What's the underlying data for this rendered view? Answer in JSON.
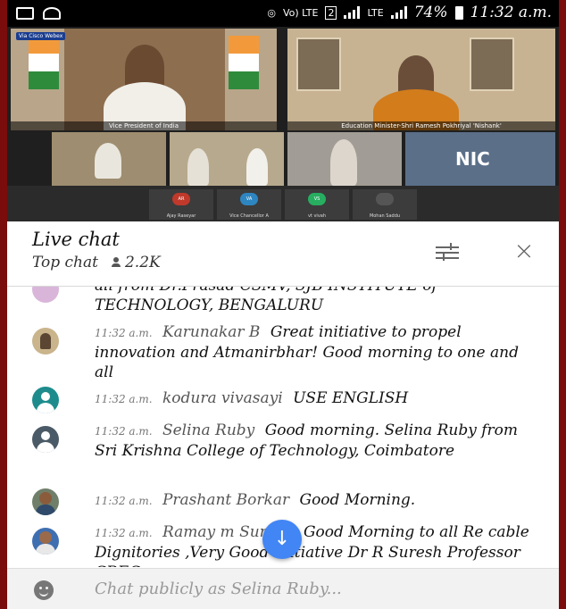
{
  "status_bar": {
    "indicators": [
      "Vo) LTE",
      "2",
      "LTE"
    ],
    "battery": "74%",
    "time": "11:32 a.m."
  },
  "video": {
    "webex_badge": "Via Cisco Webex",
    "main_caption_left": "Vice President of India",
    "main_caption_right": "Education Minister-Shri Ramesh Pokhriyal 'Nishank'",
    "nic_label": "NIC",
    "thumbnails": [
      {
        "initials": "AR",
        "name": "Ajay Raseyar",
        "color": "#c0392b"
      },
      {
        "initials": "VA",
        "name": "Vice Chancellor A",
        "color": "#2e86c1"
      },
      {
        "initials": "VS",
        "name": "vt vivah",
        "color": "#27ae60"
      },
      {
        "initials": "",
        "name": "Mohan Saddu",
        "color": "#555555"
      }
    ]
  },
  "chat_header": {
    "title": "Live chat",
    "mode": "Top chat",
    "viewers": "2.2K",
    "filter_icon": "tune-icon",
    "close_icon": "close-icon"
  },
  "messages": [
    {
      "time": "",
      "author": "",
      "text": "all from Dr.Prasad CSMV, SJB INSTITUTE of TECHNOLOGY, BENGALURU"
    },
    {
      "time": "11:32 a.m.",
      "author": "Karunakar B",
      "text": "Great initiative to propel innovation and Atmanirbhar! Good morning to one and all"
    },
    {
      "time": "11:32 a.m.",
      "author": "kodura vivasayi",
      "text": "USE ENGLISH"
    },
    {
      "time": "11:32 a.m.",
      "author": "Selina Ruby",
      "text": "Good morning. Selina Ruby from Sri Krishna College of Technology, Coimbatore"
    },
    {
      "time": "11:32 a.m.",
      "author": "Prashant Borkar",
      "text": "Good Morning."
    },
    {
      "time": "11:32 a.m.",
      "author": "Ramay   m Suresh",
      "text": "Good Morning to all Re   cable Dignitories ,Very Good Initiative Dr R Suresh Professor CREC"
    }
  ],
  "input": {
    "placeholder": "Chat publicly as Selina Ruby...",
    "emoji_icon": "emoji-icon"
  },
  "scroll_button_icon": "arrow-down-icon"
}
